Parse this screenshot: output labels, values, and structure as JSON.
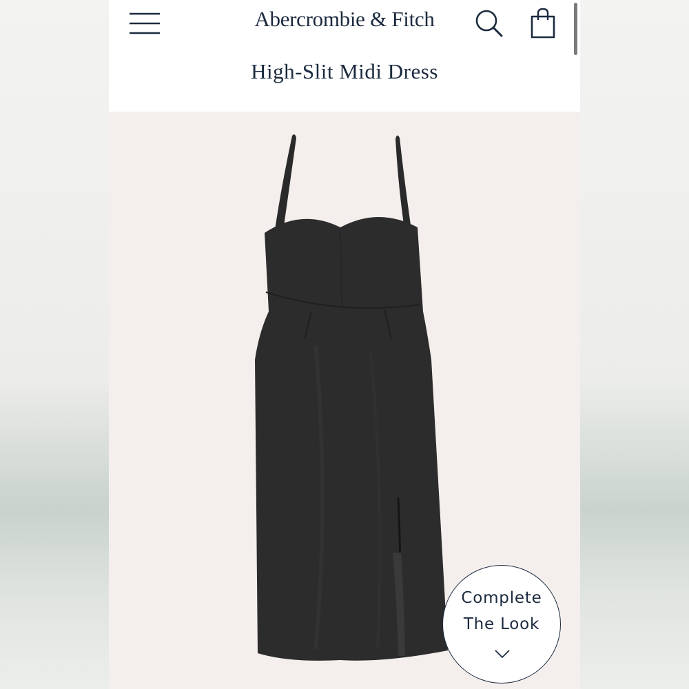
{
  "header": {
    "brand": "Abercrombie & Fitch",
    "menu_icon": "hamburger-menu-icon",
    "search_icon": "search-icon",
    "bag_icon": "shopping-bag-icon"
  },
  "product": {
    "title": "High-Slit Midi Dress",
    "image": "black-high-slit-midi-dress"
  },
  "complete_look": {
    "line1": "Complete",
    "line2": "The Look",
    "icon": "chevron-down-icon"
  },
  "colors": {
    "brand_navy": "#1b2a3e",
    "dress": "#2b2b2b",
    "image_background": "#f4efed"
  }
}
